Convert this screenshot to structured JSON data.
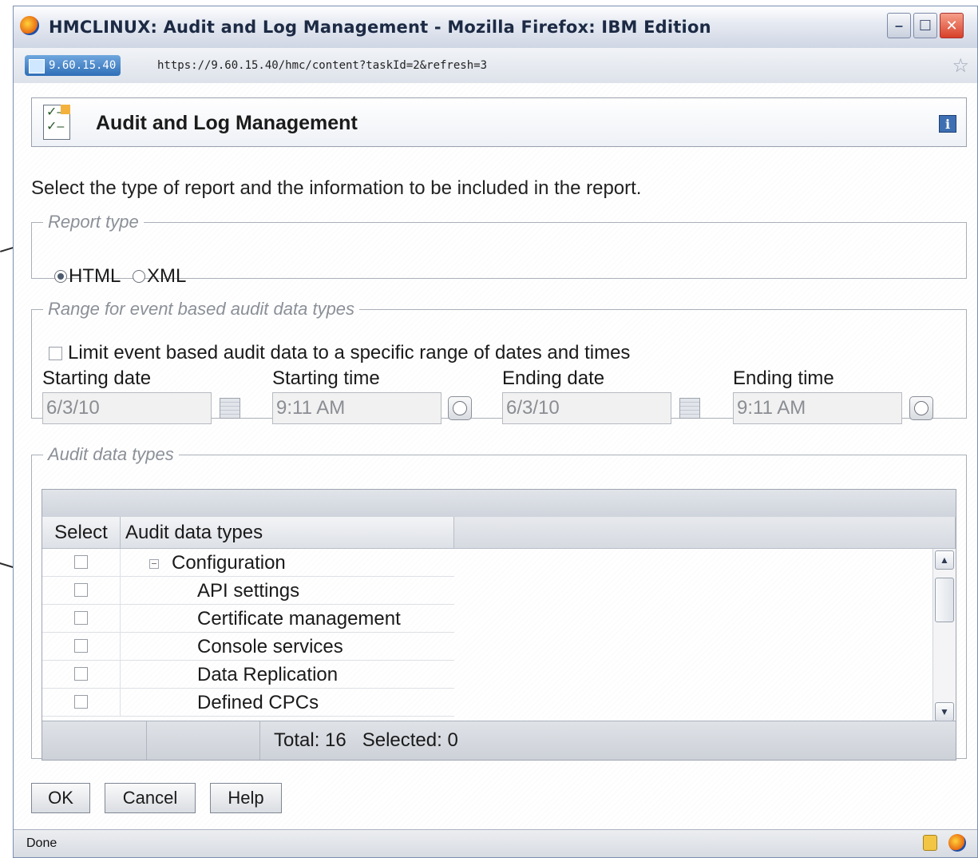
{
  "window": {
    "title": "HMCLINUX: Audit and Log Management - Mozilla Firefox: IBM Edition",
    "min_symbol": "–",
    "max_symbol": "☐",
    "close_symbol": "✕"
  },
  "urlbar": {
    "site": "9.60.15.40",
    "url": "https://9.60.15.40/hmc/content?taskId=2&refresh=3",
    "star_symbol": "☆"
  },
  "panel": {
    "title": "Audit and Log Management",
    "info_symbol": "i",
    "instruction": "Select the type of report and the information to be included in the report."
  },
  "report_type": {
    "legend": "Report type",
    "options": [
      {
        "label": "HTML",
        "selected": true
      },
      {
        "label": "XML",
        "selected": false
      }
    ]
  },
  "range": {
    "legend": "Range for event based audit data types",
    "limit_label": "Limit event based audit data to a specific range of dates and times",
    "starting_date_label": "Starting date",
    "starting_date_value": "6/3/10",
    "starting_time_label": "Starting time",
    "starting_time_value": "9:11 AM",
    "ending_date_label": "Ending date",
    "ending_date_value": "6/3/10",
    "ending_time_label": "Ending time",
    "ending_time_value": "9:11 AM"
  },
  "audit": {
    "legend": "Audit data types",
    "col_select": "Select",
    "col_types": "Audit data types",
    "rows": [
      {
        "label": "Configuration",
        "group": true
      },
      {
        "label": "API settings",
        "group": false
      },
      {
        "label": "Certificate management",
        "group": false
      },
      {
        "label": "Console services",
        "group": false
      },
      {
        "label": "Data Replication",
        "group": false
      },
      {
        "label": "Defined CPCs",
        "group": false
      }
    ],
    "footer": "Total: 16   Selected: 0",
    "scroll_up": "▲",
    "scroll_down": "▼"
  },
  "buttons": {
    "ok": "OK",
    "cancel": "Cancel",
    "help": "Help"
  },
  "status": {
    "text": "Done"
  }
}
